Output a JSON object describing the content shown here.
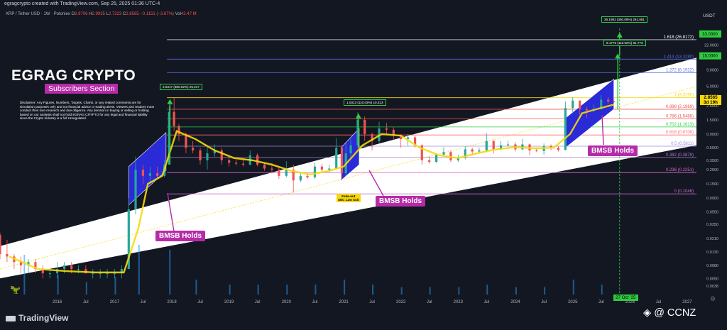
{
  "header": {
    "published": "egragcrypto created with TradingView.com, Sep 25, 2025 01:36 UTC-4",
    "symbol": "XRP / Tether USD · 1W · Poloniex",
    "ohlc": {
      "o_label": "O",
      "o": "2.9706",
      "h_label": "H",
      "h": "2.9935",
      "l_label": "L",
      "l": "2.7223",
      "c_label": "C",
      "c": "2.8565",
      "change": "−0.1151 (−3.87%)",
      "vol_label": "Vol",
      "vol": "42.47 M"
    },
    "currency": "USDT"
  },
  "brand": {
    "title": "EGRAG CRYPTO",
    "subtitle": "Subscribers Section",
    "disclaimer": "Disclaimer: Any Figures, Numbers, Targets, Charts, or any related comments are for simulation purposes only and not financial advice or trading alerts. Viewers and readers must conduct their own research and due diligence. Any decision in buying or selling or holding based on our analysis shall not hold EGRAG CRYPTO for any legal and financial liability since the Crypto Industry is a full Unregulated."
  },
  "annotations": {
    "bmsb": "BMSB Holds",
    "fakeout_line1": "Fake-out",
    "fakeout_line2": "SEC Law Suit",
    "target_2017": "2.5317 (380.02%) 25,317",
    "target_2021": "1.0313 (110.03%) 10,313",
    "target_mid": "8.1773 (110.02%) 81,773",
    "target_top": "26.1981 (350.08%) 261,981",
    "price_tag_value": "2.8565",
    "price_tag_time": "3d 19h",
    "date_marker": "27 Oct '25"
  },
  "watermark": {
    "logo": "TradingView",
    "handle": "@ CCNZ"
  },
  "colors": {
    "background": "#131722",
    "channel": "#ffffff",
    "candle_up": "#26a69a",
    "candle_down": "#ef5350",
    "bmsb_ribbon": "#f5d90a",
    "bmsb_box": "#2a2ad6",
    "arrow_green": "#2ecc40",
    "label_magenta": "#b52ba8"
  },
  "icons": [
    "tradingview-logo-icon",
    "dino-icon",
    "settings-icon",
    "binance-logo-icon"
  ],
  "chart_data": {
    "type": "candlestick",
    "scale": "log",
    "x": {
      "type": "time",
      "tick_labels": [
        "2016",
        "Jul",
        "2017",
        "Jul",
        "2018",
        "Jul",
        "2019",
        "Jul",
        "2020",
        "Jul",
        "2021",
        "Jul",
        "2022",
        "Jul",
        "2023",
        "Jul",
        "2024",
        "Jul",
        "2025",
        "Jul",
        "2026",
        "Jul",
        "2027"
      ],
      "tick_dates": [
        "2016-01-01",
        "2016-07-01",
        "2017-01-01",
        "2017-07-01",
        "2018-01-01",
        "2018-07-01",
        "2019-01-01",
        "2019-07-01",
        "2020-01-01",
        "2020-07-01",
        "2021-01-01",
        "2021-07-01",
        "2022-01-01",
        "2022-07-01",
        "2023-01-01",
        "2023-07-01",
        "2024-01-01",
        "2024-07-01",
        "2025-01-01",
        "2025-07-01",
        "2026-01-01",
        "2026-07-01",
        "2027-01-01"
      ],
      "range": [
        "2015-01-01",
        "2027-03-01"
      ]
    },
    "y": {
      "unit": "USDT",
      "tick_labels": [
        "33.0000",
        "22.0000",
        "15.0000",
        "9.0000",
        "5.0000",
        "3.5000",
        "2.5000",
        "1.5000",
        "0.9000",
        "0.5500",
        "0.3500",
        "0.2500",
        "0.1500",
        "0.0900",
        "0.0550",
        "0.0350",
        "0.0210",
        "0.0130",
        "0.0080",
        "0.0050",
        "0.0038"
      ],
      "ticks": [
        33,
        22,
        15,
        9,
        5,
        3.5,
        2.5,
        1.5,
        0.9,
        0.55,
        0.35,
        0.25,
        0.15,
        0.09,
        0.055,
        0.035,
        0.021,
        0.013,
        0.008,
        0.005,
        0.0038
      ],
      "range": [
        0.0028,
        52
      ]
    },
    "fib_levels": [
      {
        "label": "1.618 (26.8172)",
        "value": 26.8172,
        "color": "#d1d4dc"
      },
      {
        "label": "1.414 (13.3280)",
        "value": 13.328,
        "color": "#5b6ee1"
      },
      {
        "label": "1.272 (8.1922)",
        "value": 8.1922,
        "color": "#5b6ee1"
      },
      {
        "label": "1 (3.3250)",
        "value": 3.325,
        "color": "#f5d90a"
      },
      {
        "label": "0.888 (2.1969)",
        "value": 2.1969,
        "color": "#ef5350"
      },
      {
        "label": "0.786 (1.5488)",
        "value": 1.5488,
        "color": "#ef5350"
      },
      {
        "label": "0.702 (1.1613)",
        "value": 1.1613,
        "color": "#2ecc40"
      },
      {
        "label": "0.618 (0.8708)",
        "value": 0.8708,
        "color": "#ff6b6b"
      },
      {
        "label": "0.5 (0.5811)",
        "value": 0.5811,
        "color": "#9b8bd6"
      },
      {
        "label": "0.382 (0.3878)",
        "value": 0.3878,
        "color": "#a879c9"
      },
      {
        "label": "0.236 (0.2251)",
        "value": 0.2251,
        "color": "#d76bd0"
      },
      {
        "label": "0 (0.1046)",
        "value": 0.1046,
        "color": "#c86bc8"
      }
    ],
    "axis_boxes": [
      {
        "label": "33.0000",
        "value": 33,
        "color": "#2ecc40"
      },
      {
        "label": "15.0000",
        "value": 15,
        "color": "#2ecc40"
      }
    ],
    "channel": {
      "lower": [
        [
          "2015-01-01",
          0.005
        ],
        [
          "2027-03-01",
          0.6
        ]
      ],
      "upper": [
        [
          "2015-01-01",
          0.016
        ],
        [
          "2027-03-01",
          14
        ]
      ]
    },
    "candles": [
      [
        "2015-01-01",
        0.024,
        0.026,
        0.01,
        0.012
      ],
      [
        "2015-02-15",
        0.012,
        0.02,
        0.009,
        0.011
      ],
      [
        "2015-04-01",
        0.011,
        0.012,
        0.007,
        0.009
      ],
      [
        "2015-05-15",
        0.009,
        0.011,
        0.006,
        0.008
      ],
      [
        "2015-07-01",
        0.008,
        0.01,
        0.006,
        0.009
      ],
      [
        "2015-08-15",
        0.009,
        0.01,
        0.006,
        0.007
      ],
      [
        "2015-10-01",
        0.007,
        0.008,
        0.005,
        0.006
      ],
      [
        "2015-11-15",
        0.006,
        0.007,
        0.005,
        0.006
      ],
      [
        "2016-01-01",
        0.006,
        0.009,
        0.005,
        0.007
      ],
      [
        "2016-02-15",
        0.007,
        0.009,
        0.006,
        0.008
      ],
      [
        "2016-04-01",
        0.008,
        0.009,
        0.006,
        0.007
      ],
      [
        "2016-05-15",
        0.007,
        0.008,
        0.006,
        0.007
      ],
      [
        "2016-07-01",
        0.007,
        0.008,
        0.006,
        0.006
      ],
      [
        "2016-08-15",
        0.006,
        0.007,
        0.005,
        0.006
      ],
      [
        "2016-10-01",
        0.006,
        0.007,
        0.005,
        0.006
      ],
      [
        "2016-11-15",
        0.006,
        0.007,
        0.005,
        0.006
      ],
      [
        "2017-01-01",
        0.006,
        0.007,
        0.005,
        0.006
      ],
      [
        "2017-02-15",
        0.006,
        0.008,
        0.005,
        0.007
      ],
      [
        "2017-04-01",
        0.007,
        0.09,
        0.007,
        0.06
      ],
      [
        "2017-05-15",
        0.06,
        0.4,
        0.05,
        0.25
      ],
      [
        "2017-07-01",
        0.25,
        0.3,
        0.15,
        0.2
      ],
      [
        "2017-08-15",
        0.2,
        0.28,
        0.15,
        0.22
      ],
      [
        "2017-10-01",
        0.22,
        0.28,
        0.18,
        0.2
      ],
      [
        "2017-11-15",
        0.2,
        0.35,
        0.19,
        0.3
      ],
      [
        "2017-12-15",
        0.3,
        2.5,
        0.3,
        2.0
      ],
      [
        "2018-01-15",
        2.0,
        3.3,
        1.0,
        1.2
      ],
      [
        "2018-02-15",
        1.2,
        1.3,
        0.7,
        0.9
      ],
      [
        "2018-04-01",
        0.9,
        0.95,
        0.45,
        0.55
      ],
      [
        "2018-05-15",
        0.55,
        0.7,
        0.45,
        0.5
      ],
      [
        "2018-07-01",
        0.5,
        0.55,
        0.3,
        0.35
      ],
      [
        "2018-08-15",
        0.35,
        0.6,
        0.25,
        0.45
      ],
      [
        "2018-10-01",
        0.45,
        0.62,
        0.4,
        0.5
      ],
      [
        "2018-11-15",
        0.5,
        0.55,
        0.3,
        0.35
      ],
      [
        "2019-01-01",
        0.35,
        0.4,
        0.28,
        0.32
      ],
      [
        "2019-02-15",
        0.32,
        0.36,
        0.29,
        0.31
      ],
      [
        "2019-04-01",
        0.31,
        0.38,
        0.28,
        0.3
      ],
      [
        "2019-05-15",
        0.3,
        0.5,
        0.29,
        0.42
      ],
      [
        "2019-07-01",
        0.42,
        0.45,
        0.28,
        0.3
      ],
      [
        "2019-08-15",
        0.3,
        0.32,
        0.24,
        0.26
      ],
      [
        "2019-10-01",
        0.26,
        0.32,
        0.22,
        0.25
      ],
      [
        "2019-11-15",
        0.25,
        0.28,
        0.18,
        0.2
      ],
      [
        "2020-01-01",
        0.2,
        0.34,
        0.19,
        0.25
      ],
      [
        "2020-02-15",
        0.25,
        0.3,
        0.11,
        0.17
      ],
      [
        "2020-04-01",
        0.17,
        0.23,
        0.16,
        0.2
      ],
      [
        "2020-05-15",
        0.2,
        0.22,
        0.18,
        0.19
      ],
      [
        "2020-07-01",
        0.19,
        0.32,
        0.18,
        0.28
      ],
      [
        "2020-08-15",
        0.28,
        0.31,
        0.23,
        0.25
      ],
      [
        "2020-10-01",
        0.25,
        0.3,
        0.23,
        0.26
      ],
      [
        "2020-11-15",
        0.26,
        0.78,
        0.25,
        0.55
      ],
      [
        "2020-12-20",
        0.55,
        0.6,
        0.17,
        0.22
      ],
      [
        "2021-01-15",
        0.22,
        0.65,
        0.2,
        0.45
      ],
      [
        "2021-02-15",
        0.45,
        0.75,
        0.4,
        0.6
      ],
      [
        "2021-04-01",
        0.6,
        1.96,
        0.55,
        1.5
      ],
      [
        "2021-05-15",
        1.5,
        1.7,
        0.7,
        0.9
      ],
      [
        "2021-07-01",
        0.9,
        0.95,
        0.5,
        0.7
      ],
      [
        "2021-08-15",
        0.7,
        1.4,
        0.65,
        1.1
      ],
      [
        "2021-10-01",
        1.1,
        1.35,
        0.9,
        1.05
      ],
      [
        "2021-11-15",
        1.05,
        1.15,
        0.75,
        0.85
      ],
      [
        "2022-01-01",
        0.85,
        0.9,
        0.55,
        0.75
      ],
      [
        "2022-02-15",
        0.75,
        0.9,
        0.6,
        0.8
      ],
      [
        "2022-04-01",
        0.8,
        0.85,
        0.55,
        0.6
      ],
      [
        "2022-05-15",
        0.6,
        0.62,
        0.3,
        0.35
      ],
      [
        "2022-07-01",
        0.35,
        0.4,
        0.31,
        0.33
      ],
      [
        "2022-08-15",
        0.33,
        0.45,
        0.32,
        0.43
      ],
      [
        "2022-10-01",
        0.43,
        0.56,
        0.42,
        0.47
      ],
      [
        "2022-11-15",
        0.47,
        0.5,
        0.33,
        0.35
      ],
      [
        "2023-01-01",
        0.35,
        0.43,
        0.33,
        0.39
      ],
      [
        "2023-02-15",
        0.39,
        0.58,
        0.36,
        0.52
      ],
      [
        "2023-04-01",
        0.52,
        0.55,
        0.43,
        0.48
      ],
      [
        "2023-05-15",
        0.48,
        0.55,
        0.45,
        0.5
      ],
      [
        "2023-07-01",
        0.5,
        0.93,
        0.47,
        0.7
      ],
      [
        "2023-08-15",
        0.7,
        0.72,
        0.45,
        0.52
      ],
      [
        "2023-10-01",
        0.52,
        0.7,
        0.5,
        0.6
      ],
      [
        "2023-11-15",
        0.6,
        0.7,
        0.58,
        0.62
      ],
      [
        "2024-01-01",
        0.62,
        0.67,
        0.48,
        0.52
      ],
      [
        "2024-02-15",
        0.52,
        0.75,
        0.5,
        0.62
      ],
      [
        "2024-04-01",
        0.62,
        0.64,
        0.42,
        0.5
      ],
      [
        "2024-05-15",
        0.5,
        0.55,
        0.47,
        0.49
      ],
      [
        "2024-07-01",
        0.49,
        0.64,
        0.43,
        0.58
      ],
      [
        "2024-08-15",
        0.58,
        0.62,
        0.5,
        0.55
      ],
      [
        "2024-10-01",
        0.55,
        0.58,
        0.48,
        0.51
      ],
      [
        "2024-11-15",
        0.51,
        2.9,
        0.5,
        2.3
      ],
      [
        "2025-01-01",
        2.3,
        3.4,
        1.9,
        3.0
      ],
      [
        "2025-02-15",
        3.0,
        3.0,
        1.8,
        2.2
      ],
      [
        "2025-04-01",
        2.2,
        2.4,
        1.6,
        2.1
      ],
      [
        "2025-05-15",
        2.1,
        2.6,
        2.0,
        2.2
      ],
      [
        "2025-07-01",
        2.2,
        3.66,
        2.2,
        3.1
      ],
      [
        "2025-08-15",
        3.1,
        3.4,
        2.7,
        2.9
      ],
      [
        "2025-09-20",
        2.9706,
        2.9935,
        2.7223,
        2.8565
      ]
    ],
    "bmsb_ribbon": [
      [
        "2015-03-01",
        0.011
      ],
      [
        "2015-09-01",
        0.007
      ],
      [
        "2016-03-01",
        0.0065
      ],
      [
        "2016-09-01",
        0.0062
      ],
      [
        "2017-03-01",
        0.0062
      ],
      [
        "2017-06-01",
        0.03
      ],
      [
        "2017-08-01",
        0.15
      ],
      [
        "2017-11-01",
        0.2
      ],
      [
        "2018-02-01",
        1.0
      ],
      [
        "2018-06-01",
        0.75
      ],
      [
        "2018-10-01",
        0.5
      ],
      [
        "2019-02-01",
        0.38
      ],
      [
        "2019-06-01",
        0.35
      ],
      [
        "2019-10-01",
        0.3
      ],
      [
        "2020-02-01",
        0.24
      ],
      [
        "2020-06-01",
        0.21
      ],
      [
        "2020-10-01",
        0.24
      ],
      [
        "2021-01-01",
        0.28
      ],
      [
        "2021-05-01",
        0.6
      ],
      [
        "2021-09-01",
        0.9
      ],
      [
        "2022-01-01",
        0.85
      ],
      [
        "2022-05-01",
        0.55
      ],
      [
        "2022-09-01",
        0.42
      ],
      [
        "2023-01-01",
        0.38
      ],
      [
        "2023-05-01",
        0.45
      ],
      [
        "2023-09-01",
        0.52
      ],
      [
        "2024-01-01",
        0.56
      ],
      [
        "2024-05-01",
        0.54
      ],
      [
        "2024-09-01",
        0.55
      ],
      [
        "2024-12-15",
        0.9
      ],
      [
        "2025-03-01",
        1.9
      ],
      [
        "2025-06-01",
        2.2
      ],
      [
        "2025-09-20",
        2.6
      ]
    ],
    "bmsb_boxes": [
      {
        "start": "2017-04-01",
        "end": "2017-11-25",
        "low_start": 0.07,
        "low_end": 0.24,
        "high_start": 0.28,
        "high_end": 0.95
      },
      {
        "start": "2020-12-15",
        "end": "2021-04-10",
        "low_start": 0.17,
        "low_end": 0.3,
        "high_start": 0.55,
        "high_end": 1.1
      },
      {
        "start": "2024-11-15",
        "end": "2025-09-20",
        "low_start": 0.55,
        "low_end": 2.2,
        "high_start": 1.6,
        "high_end": 6.5
      }
    ],
    "projection_arrows": [
      {
        "from_date": "2017-12-20",
        "from_value": 0.3,
        "to_date": "2017-12-20",
        "to_value": 3.0
      },
      {
        "from_date": "2021-04-05",
        "from_value": 0.55,
        "to_date": "2021-04-05",
        "to_value": 1.8
      },
      {
        "from_date": "2025-10-15",
        "from_value": 2.2,
        "to_date": "2025-10-15",
        "to_value": 15.5
      },
      {
        "from_date": "2025-10-27",
        "from_value": 15.0,
        "to_date": "2025-10-27",
        "to_value": 33.0
      }
    ],
    "vertical_marker": {
      "date": "2025-10-27"
    },
    "diagonal_projection": [
      [
        "2015-01-01",
        0.007
      ],
      [
        "2027-03-01",
        5.0
      ]
    ],
    "volume": [
      [
        "2015-06-01",
        0.8
      ],
      [
        "2016-01-01",
        0.4
      ],
      [
        "2016-07-01",
        0.25
      ],
      [
        "2017-01-01",
        0.35
      ],
      [
        "2017-06-01",
        1.0
      ],
      [
        "2017-12-15",
        0.9
      ],
      [
        "2018-06-01",
        0.3
      ],
      [
        "2019-01-01",
        0.2
      ],
      [
        "2019-07-01",
        0.2
      ],
      [
        "2020-01-01",
        0.2
      ],
      [
        "2020-07-01",
        0.2
      ],
      [
        "2021-01-01",
        0.3
      ],
      [
        "2021-07-01",
        0.2
      ],
      [
        "2022-01-01",
        0.15
      ],
      [
        "2022-07-01",
        0.15
      ],
      [
        "2023-01-01",
        0.15
      ],
      [
        "2023-07-01",
        0.2
      ],
      [
        "2024-01-01",
        0.15
      ],
      [
        "2024-07-01",
        0.15
      ],
      [
        "2025-01-01",
        0.3
      ],
      [
        "2025-07-01",
        0.2
      ]
    ]
  }
}
